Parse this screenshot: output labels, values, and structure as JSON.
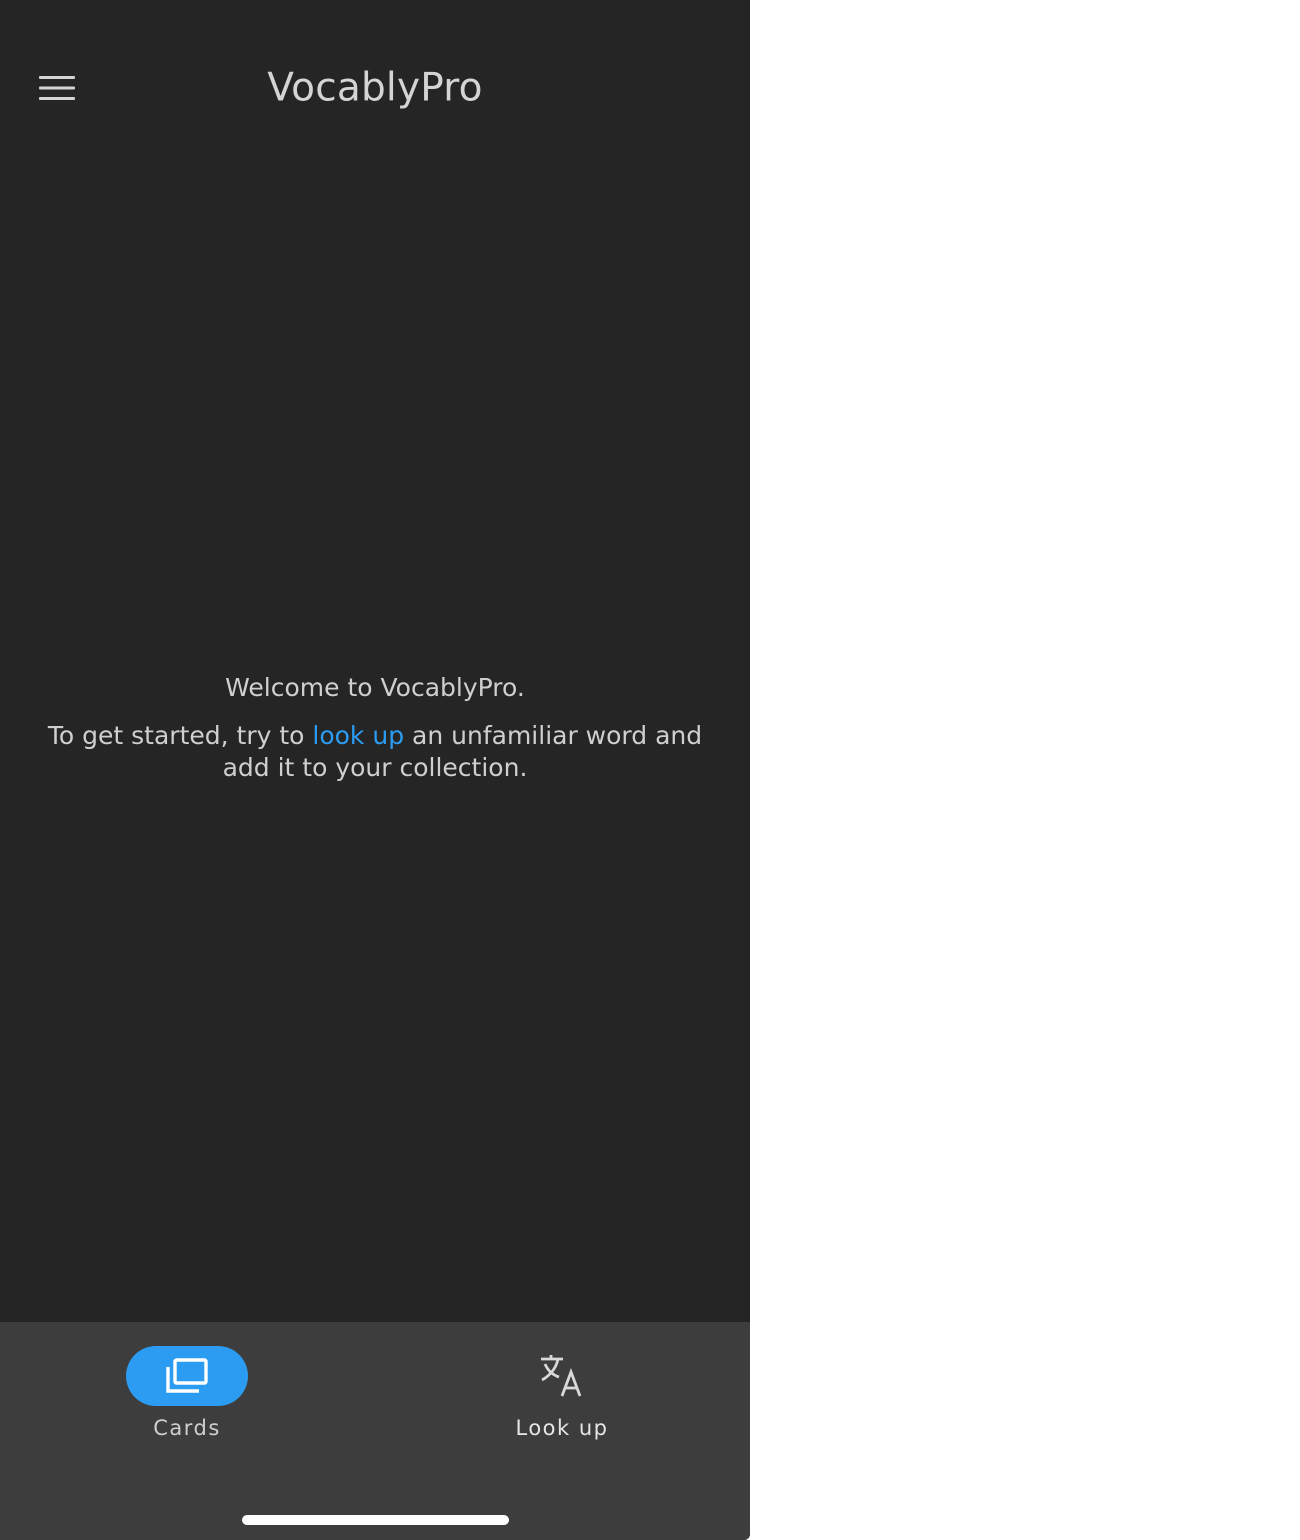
{
  "app": {
    "title": "VocablyPro"
  },
  "colors": {
    "background": "#252525",
    "nav_background": "#3d3d3d",
    "accent": "#2b9cf2",
    "text": "#cfcfcf"
  },
  "header": {
    "menu_icon": "hamburger-menu-icon"
  },
  "empty_state": {
    "welcome": "Welcome to VocablyPro.",
    "hint_before": "To get started, try to ",
    "hint_link": "look up",
    "hint_after": " an unfamiliar word and add it to your collection."
  },
  "bottom_nav": {
    "items": [
      {
        "label": "Cards",
        "icon": "cards-icon",
        "active": true
      },
      {
        "label": "Look up",
        "icon": "translate-icon",
        "active": false
      }
    ]
  }
}
